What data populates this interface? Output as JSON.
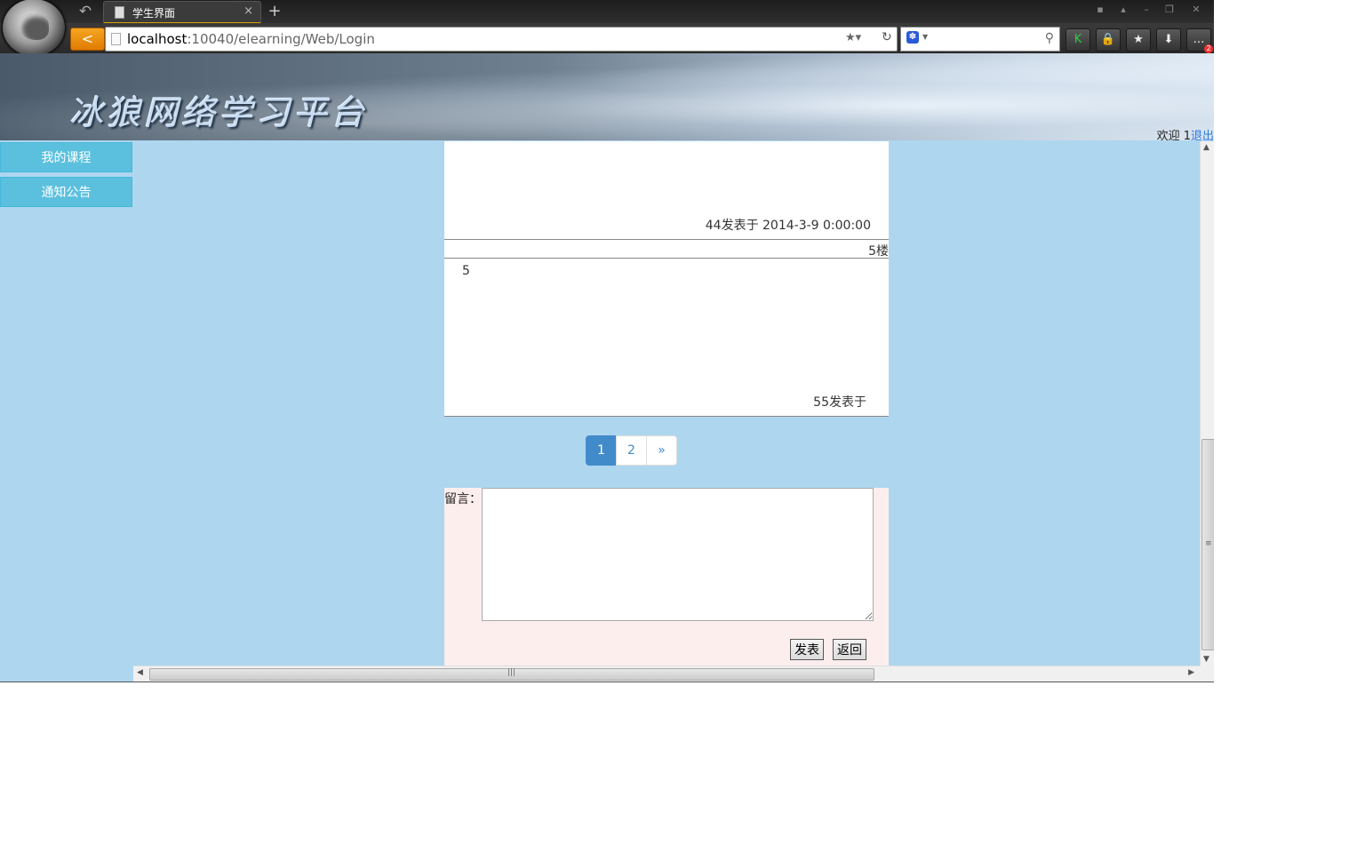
{
  "browser": {
    "tab_title": "学生界面",
    "tab_close": "×",
    "new_tab": "+",
    "url_host": "localhost",
    "url_rest": ":10040/elearning/Web/Login",
    "back_glyph": "<",
    "history_glyph": "↶",
    "window_controls": [
      "▪",
      "▴",
      "–",
      "❐",
      "✕"
    ],
    "toolbar_buttons": [
      "K",
      "🔒",
      "★",
      "⬇",
      "…"
    ],
    "badge_count": "2"
  },
  "header": {
    "site_title": "冰狼网络学习平台",
    "welcome_text": "欢迎 1",
    "logout_label": "退出"
  },
  "sidebar": {
    "items": [
      {
        "label": "我的课程"
      },
      {
        "label": "通知公告"
      }
    ]
  },
  "posts": [
    {
      "meta": "44发表于 2014-3-9 0:00:00"
    },
    {
      "floor": "5楼",
      "body": "5",
      "meta": "55发表于"
    }
  ],
  "pagination": {
    "pages": [
      "1",
      "2"
    ],
    "next": "»",
    "current": "1"
  },
  "comment_form": {
    "label": "留言：",
    "text_value": "",
    "submit_label": "发表",
    "back_label": "返回"
  },
  "colors": {
    "page_background": "#aed6ef",
    "sidebar_button": "#5bc0de",
    "pager_active": "#428bca",
    "comment_box": "#fdeeee",
    "back_button": "#e07b00"
  }
}
